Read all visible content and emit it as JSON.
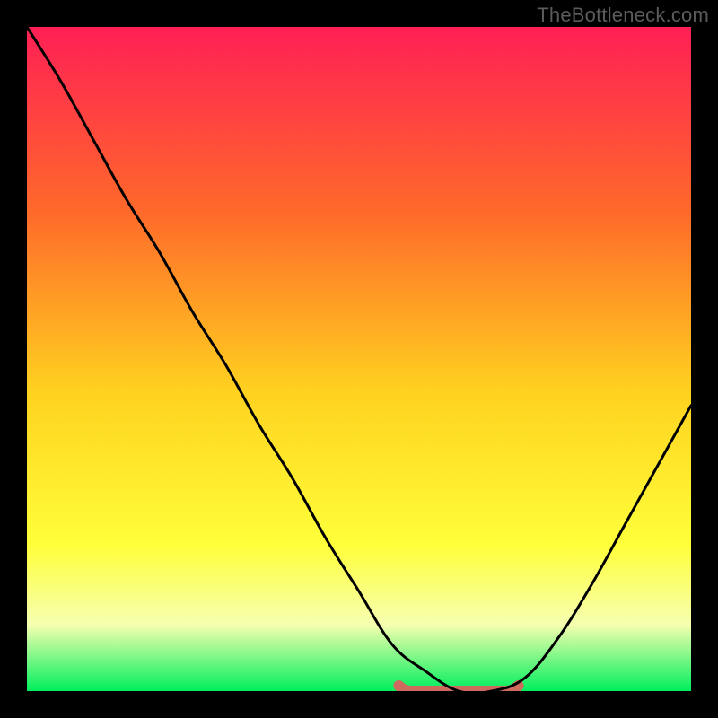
{
  "watermark": "TheBottleneck.com",
  "colors": {
    "background": "#000000",
    "gradient_top": "#ff1f55",
    "gradient_mid1": "#ff6a2a",
    "gradient_mid2": "#ffd21f",
    "gradient_mid3": "#ffff3a",
    "gradient_pale": "#f6ffb0",
    "gradient_bottom": "#00ef5d",
    "curve": "#000000",
    "marker": "#cf6a5e"
  },
  "chart_data": {
    "type": "line",
    "title": "",
    "xlabel": "",
    "ylabel": "",
    "x": [
      0.0,
      0.05,
      0.1,
      0.15,
      0.2,
      0.25,
      0.3,
      0.35,
      0.4,
      0.45,
      0.5,
      0.55,
      0.6,
      0.65,
      0.7,
      0.75,
      0.8,
      0.85,
      0.9,
      0.95,
      1.0
    ],
    "values": [
      100,
      92,
      83,
      74,
      66,
      57,
      49,
      40,
      32,
      23,
      15,
      7,
      3,
      0,
      0,
      2,
      8,
      16,
      25,
      34,
      43
    ],
    "xlim": [
      0,
      1
    ],
    "ylim": [
      0,
      100
    ],
    "marker_range_x": [
      0.56,
      0.74
    ],
    "marker_y": 0
  }
}
